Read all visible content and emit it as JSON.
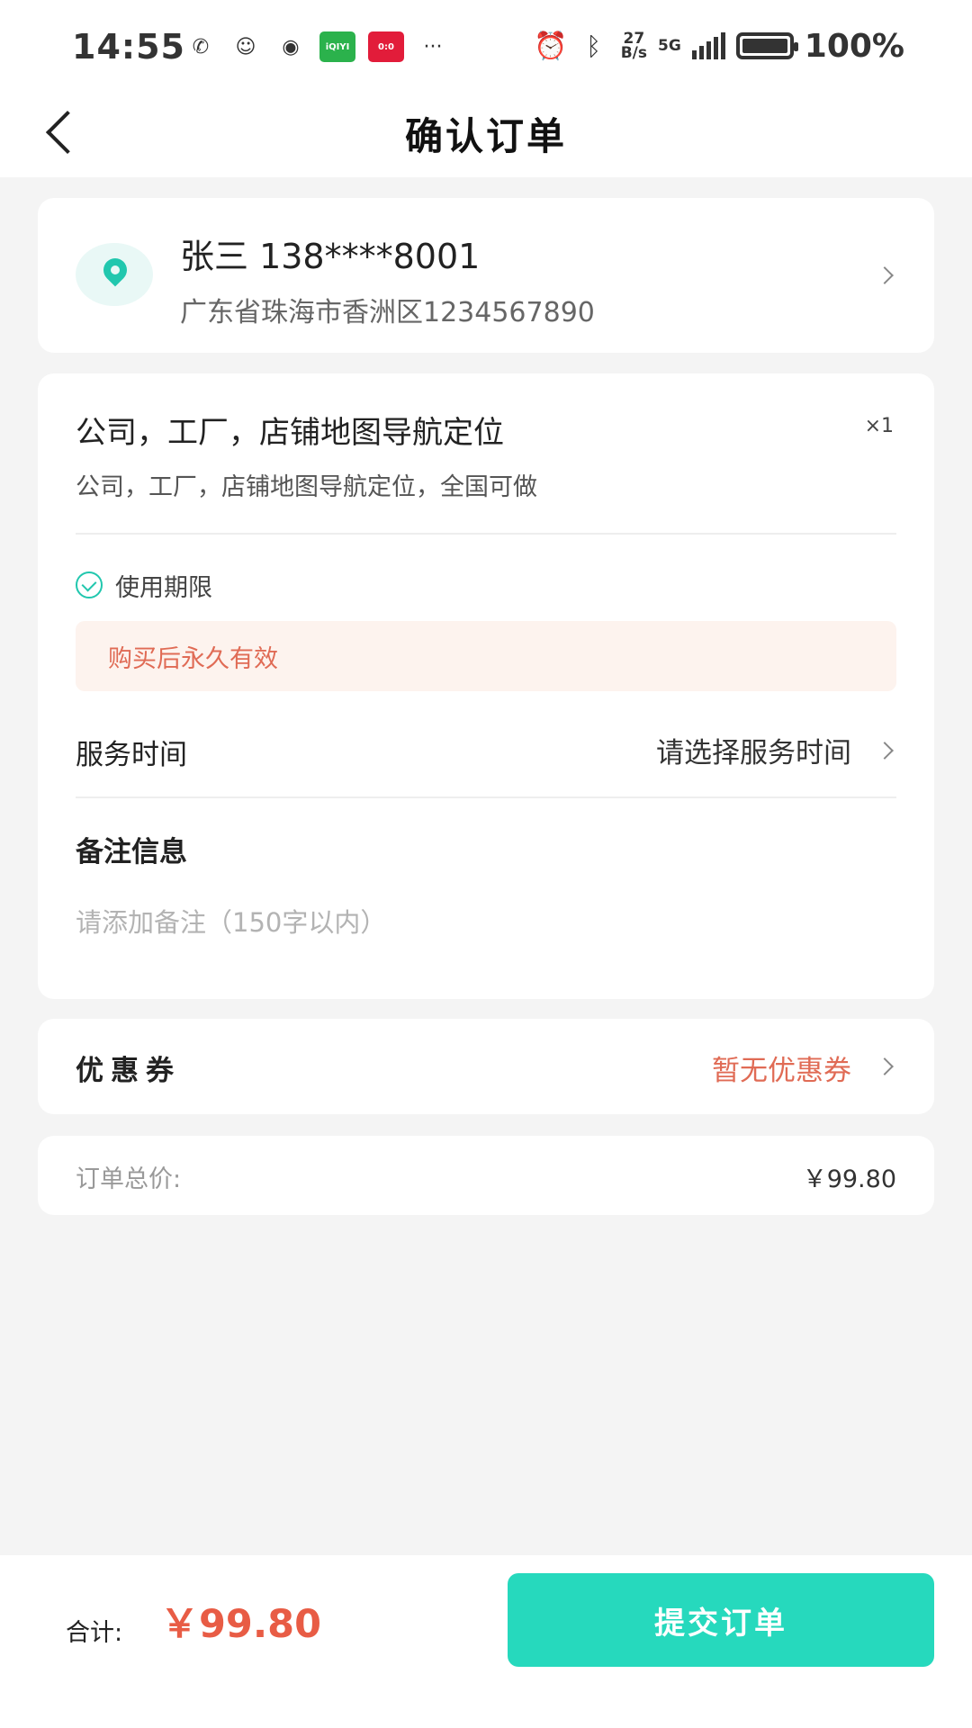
{
  "status_bar": {
    "time": "14:55",
    "app_iqiyi": "iQIYI",
    "app_tmall": "0:0",
    "more": "···",
    "net_speed_top": "27",
    "net_speed_bottom": "B/s",
    "network": "5G",
    "battery_percent": "100%"
  },
  "header": {
    "title": "确认订单"
  },
  "address": {
    "name_phone": "张三 138****8001",
    "detail": "广东省珠海市香洲区1234567890"
  },
  "order": {
    "service_title": "公司，工厂，店铺地图导航定位",
    "quantity": "×1",
    "service_desc": "公司，工厂，店铺地图导航定位，全国可做",
    "validity_label": "使用期限",
    "validity_text": "购买后永久有效",
    "service_time_label": "服务时间",
    "service_time_value": "请选择服务时间",
    "remark_label": "备注信息",
    "remark_placeholder": "请添加备注（150字以内）",
    "remark_value": ""
  },
  "coupon": {
    "label": "优惠券",
    "value": "暂无优惠券"
  },
  "total": {
    "label": "订单总价:",
    "value": "￥99.80"
  },
  "bottom_bar": {
    "sum_label": "合计:",
    "sum_value": "￥99.80",
    "submit_label": "提交订单"
  },
  "colors": {
    "accent": "#26d9bd",
    "price_red": "#e85c45",
    "notice_bg": "#fdf3ee"
  }
}
